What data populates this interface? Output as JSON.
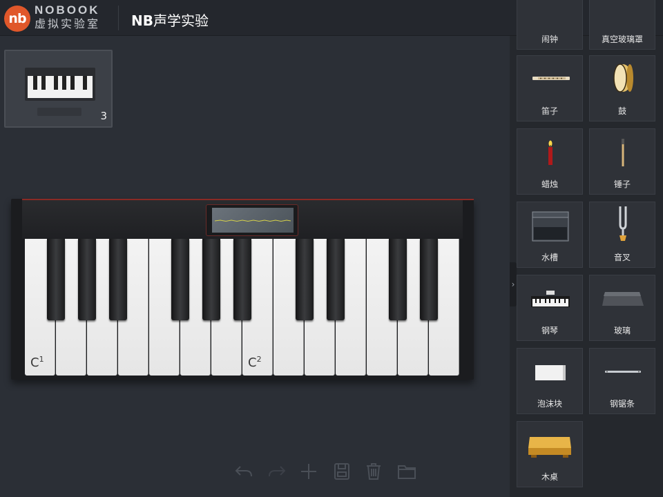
{
  "header": {
    "logo_mark": "nb",
    "brand_en": "NOBOOK",
    "brand_cn": "虚拟实验室",
    "title_prefix": "NB",
    "title_rest": "声学实验",
    "sound_icon": "speaker-icon",
    "settings_icon": "gear-icon",
    "accent_color": "#e0572a"
  },
  "thumbnail": {
    "count": "3"
  },
  "piano": {
    "label_c1_base": "C",
    "label_c1_sup": "1",
    "label_c2_base": "C",
    "label_c2_sup": "2"
  },
  "toolbar": [
    "undo-icon",
    "redo-icon",
    "add-icon",
    "save-icon",
    "delete-icon",
    "folder-icon"
  ],
  "sidebar": {
    "items": [
      {
        "label": "闹钟",
        "icon": "alarm-clock-icon"
      },
      {
        "label": "真空玻璃罩",
        "icon": "vacuum-bell-jar-icon"
      },
      {
        "label": "笛子",
        "icon": "flute-icon"
      },
      {
        "label": "鼓",
        "icon": "drum-icon"
      },
      {
        "label": "蜡烛",
        "icon": "candle-icon"
      },
      {
        "label": "锤子",
        "icon": "mallet-icon"
      },
      {
        "label": "水槽",
        "icon": "water-tank-icon"
      },
      {
        "label": "音叉",
        "icon": "tuning-fork-icon"
      },
      {
        "label": "钢琴",
        "icon": "piano-icon"
      },
      {
        "label": "玻璃",
        "icon": "glass-icon"
      },
      {
        "label": "泡沫块",
        "icon": "foam-block-icon"
      },
      {
        "label": "钢锯条",
        "icon": "saw-blade-icon"
      },
      {
        "label": "木桌",
        "icon": "wooden-table-icon"
      }
    ],
    "collapse_glyph": "›"
  }
}
